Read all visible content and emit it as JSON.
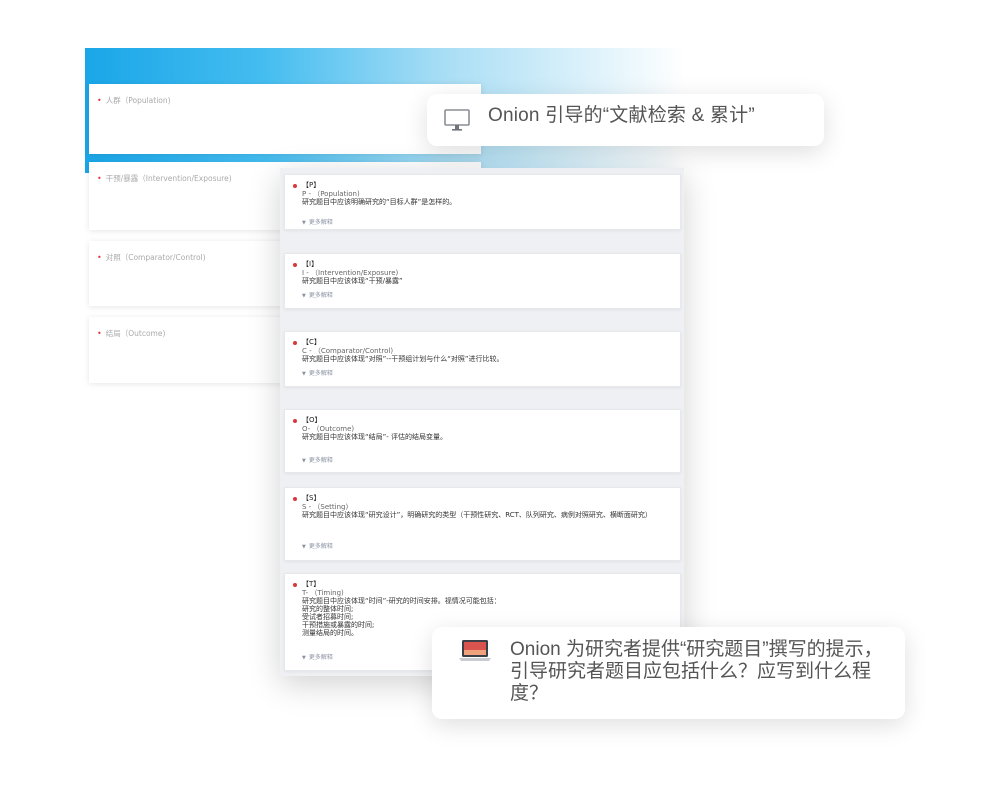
{
  "colors": {
    "hero_gradient_start": "#1aa6e8",
    "required_marker": "#e0393e",
    "bullet": "#d8383c",
    "more_link": "#8a93a3"
  },
  "background_form": {
    "fields": [
      {
        "label": "人群（Population)"
      },
      {
        "label": "干预/暴露（Intervention/Exposure)"
      },
      {
        "label": "对照（Comparator/Control)"
      },
      {
        "label": "结局（Outcome)"
      }
    ]
  },
  "callouts": {
    "top": {
      "icon": "monitor-icon",
      "text": "Onion 引导的“文献检索 & 累计”"
    },
    "bottom": {
      "icon": "laptop-icon",
      "text": "Onion 为研究者提供“研究题目”撰写的提示，引导研究者题目应包括什么？应写到什么程度？"
    }
  },
  "hint_cards": [
    {
      "tag": "【P】",
      "subtitle": "P - （Population)",
      "desc": [
        "研究题目中应该明确研究的“目标人群”是怎样的。"
      ],
      "more": "更多解释"
    },
    {
      "tag": "【I】",
      "subtitle": "I - （Intervention/Exposure)",
      "desc": [
        "研究题目中应该体现“干预/暴露”"
      ],
      "more": "更多解释"
    },
    {
      "tag": "【C】",
      "subtitle": "C - （Comparator/Control)",
      "desc": [
        "研究题目中应该体现“对照”--干预组计划与什么“对照”进行比较。"
      ],
      "more": "更多解释"
    },
    {
      "tag": "【O】",
      "subtitle": "O- （Outcome)",
      "desc": [
        "研究题目中应该体现“结局”- 评估的结局变量。"
      ],
      "more": "更多解释"
    },
    {
      "tag": "【S】",
      "subtitle": "S - （Setting)",
      "desc": [
        "研究题目中应该体现“研究设计”，明确研究的类型（干预性研究、RCT、队列研究、病例对照研究、横断面研究）"
      ],
      "more": "更多解释"
    },
    {
      "tag": "【T】",
      "subtitle": "T- （Timing)",
      "desc": [
        "研究题目中应该体现“时间”-研究的时间安排。视情况可能包括：",
        "研究的整体时间;",
        "受试者招募时间;",
        "干预措施或暴露的时间;",
        "测量结局的时间。"
      ],
      "more": "更多解释"
    }
  ]
}
